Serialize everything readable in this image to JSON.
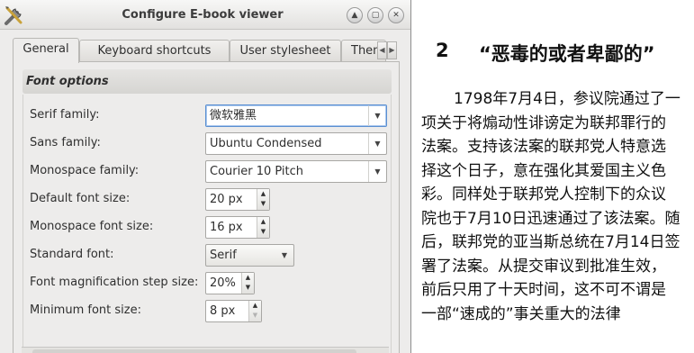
{
  "dialog": {
    "title": "Configure E-book viewer",
    "window_buttons": {
      "restore": "▲",
      "minimize": "▢",
      "close": "✕"
    }
  },
  "tabs": [
    {
      "label": "General",
      "active": true
    },
    {
      "label": "Keyboard shortcuts",
      "active": false
    },
    {
      "label": "User stylesheet",
      "active": false
    },
    {
      "label": "Them",
      "active": false
    }
  ],
  "tab_scroll": {
    "left": "◀",
    "right": "▶"
  },
  "font_options": {
    "header": "Font options",
    "serif_label": "Serif family:",
    "serif_value": "微软雅黑",
    "sans_label": "Sans family:",
    "sans_value": "Ubuntu Condensed",
    "mono_label": "Monospace family:",
    "mono_value": "Courier 10 Pitch",
    "default_size_label": "Default font size:",
    "default_size_value": "20 px",
    "mono_size_label": "Monospace font size:",
    "mono_size_value": "16 px",
    "standard_font_label": "Standard font:",
    "standard_font_value": "Serif",
    "mag_step_label": "Font magnification step size:",
    "mag_step_value": "20%",
    "min_size_label": "Minimum font size:",
    "min_size_value": "8 px"
  },
  "icons": {
    "combo_arrow": "▼",
    "spin_up": "▲",
    "spin_down": "▼"
  },
  "reader": {
    "chapter_number": "2",
    "chapter_title": "“恶毒的或者卑鄙的”",
    "paragraph": "1798年7月4日，参议院通过了一项关于将煽动性诽谤定为联邦罪行的法案。支持该法案的联邦党人特意选择这个日子，意在强化其爱国主义色彩。同样处于联邦党人控制下的众议院也于7月10日迅速通过了该法案。随后，联邦党的亚当斯总统在7月14日签署了法案。从提交审议到批准生效，前后只用了十天时间，这不可不谓是一部“速成的”事关重大的法律"
  }
}
